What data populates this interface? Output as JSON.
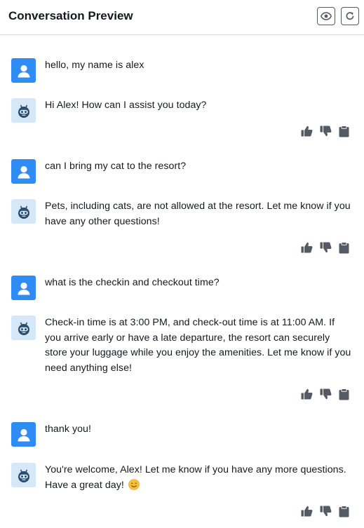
{
  "header": {
    "title": "Conversation Preview",
    "view_button": "eye-icon",
    "refresh_button": "refresh-icon"
  },
  "colors": {
    "user_avatar": "#2f8cf4",
    "bot_avatar_bg": "#d6e7f7",
    "bot_avatar_fg": "#2a4d6e",
    "icon": "#545b64"
  },
  "messages": [
    {
      "role": "user",
      "text": "hello, my name is alex"
    },
    {
      "role": "bot",
      "text": "Hi Alex! How can I assist you today?"
    },
    {
      "role": "user",
      "text": "can I bring my cat to the resort?"
    },
    {
      "role": "bot",
      "text": "Pets, including cats, are not allowed at the resort. Let me know if you have any other questions!"
    },
    {
      "role": "user",
      "text": "what is the checkin and checkout time?"
    },
    {
      "role": "bot",
      "text": "Check-in time is at 3:00 PM, and check-out time is at 11:00 AM. If you arrive early or have a late departure, the resort can securely store your luggage while you enjoy the amenities. Let me know if you need anything else!"
    },
    {
      "role": "user",
      "text": "thank you!"
    },
    {
      "role": "bot",
      "text": "You're welcome, Alex! Let me know if you have any more questions. Have a great day!",
      "emoji": "smiling-face-emoji"
    }
  ],
  "actions": {
    "thumbs_up": "thumbs-up-icon",
    "thumbs_down": "thumbs-down-icon",
    "copy": "clipboard-icon"
  }
}
